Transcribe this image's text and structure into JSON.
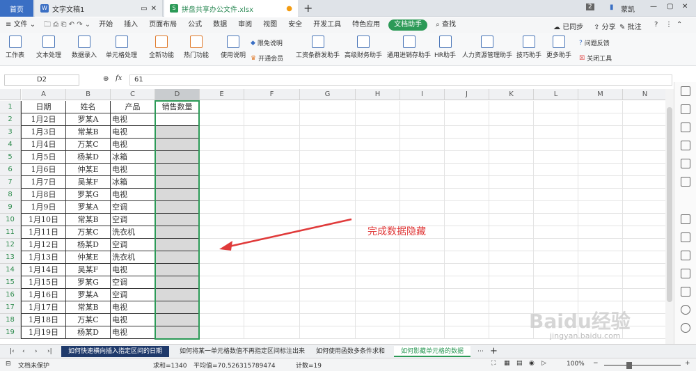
{
  "tabs": {
    "home": "首页",
    "doc": "文字文稿1",
    "xls": "拼盘共享办公文件.xlsx",
    "count": "2",
    "user": "蒙凯"
  },
  "menu": {
    "file": "文件",
    "items": [
      "开始",
      "插入",
      "页面布局",
      "公式",
      "数据",
      "审阅",
      "视图",
      "安全",
      "开发工具",
      "特色应用",
      "文档助手"
    ],
    "search": "查找",
    "sync": "已同步",
    "share": "分享",
    "comment": "批注"
  },
  "ribbon": {
    "big": [
      "工作表",
      "文本处理",
      "数据录入",
      "单元格处理",
      "全新功能",
      "热门功能",
      "使用说明",
      "工资条群发助手",
      "高级财务助手",
      "通用进销存助手",
      "HR助手",
      "人力资源管理助手",
      "技巧助手",
      "更多助手"
    ],
    "limited": "限免说明",
    "member": "开通会员",
    "feedback": "问题反馈",
    "close": "关闭工具"
  },
  "formula": {
    "name": "D2",
    "value": "61"
  },
  "columns": [
    "A",
    "B",
    "C",
    "D",
    "E",
    "F",
    "G",
    "H",
    "I",
    "J",
    "K",
    "L",
    "M",
    "N"
  ],
  "rows": [
    "1",
    "2",
    "3",
    "4",
    "5",
    "6",
    "7",
    "8",
    "9",
    "10",
    "11",
    "12",
    "13",
    "14",
    "15",
    "16",
    "17",
    "18",
    "19"
  ],
  "headers": [
    "日期",
    "姓名",
    "产品",
    "销售数量"
  ],
  "data": [
    [
      "1月2日",
      "罗某A",
      "电视"
    ],
    [
      "1月3日",
      "常某B",
      "电视"
    ],
    [
      "1月4日",
      "万某C",
      "电视"
    ],
    [
      "1月5日",
      "杨某D",
      "冰箱"
    ],
    [
      "1月6日",
      "仲某E",
      "电视"
    ],
    [
      "1月7日",
      "吴某F",
      "冰箱"
    ],
    [
      "1月8日",
      "罗某G",
      "电视"
    ],
    [
      "1月9日",
      "罗某A",
      "空调"
    ],
    [
      "1月10日",
      "常某B",
      "空调"
    ],
    [
      "1月11日",
      "万某C",
      "洗衣机"
    ],
    [
      "1月12日",
      "杨某D",
      "空调"
    ],
    [
      "1月13日",
      "仲某E",
      "洗衣机"
    ],
    [
      "1月14日",
      "吴某F",
      "电视"
    ],
    [
      "1月15日",
      "罗某G",
      "空调"
    ],
    [
      "1月16日",
      "罗某A",
      "空调"
    ],
    [
      "1月17日",
      "常某B",
      "电视"
    ],
    [
      "1月18日",
      "万某C",
      "电视"
    ],
    [
      "1月19日",
      "杨某D",
      "电视"
    ]
  ],
  "annotation": "完成数据隐藏",
  "sheets": [
    "如何快速横向插入指定区间的日期",
    "如何将某一单元格数值不再指定区间标注出来",
    "如何使用函数多条件求和",
    "如何影藏单元格的数据"
  ],
  "status": {
    "protect": "文档未保护",
    "sum": "求和=1340",
    "avg": "平均值=70.526315789474",
    "count": "计数=19",
    "zoom": "100%"
  },
  "watermark": {
    "brand": "Baidu经验",
    "url": "jingyan.baidu.com"
  },
  "colors": {
    "accent": "#2c9a57",
    "arrow": "#e03a3a",
    "home": "#3a6fc4",
    "selected": "#d9d9d9"
  }
}
